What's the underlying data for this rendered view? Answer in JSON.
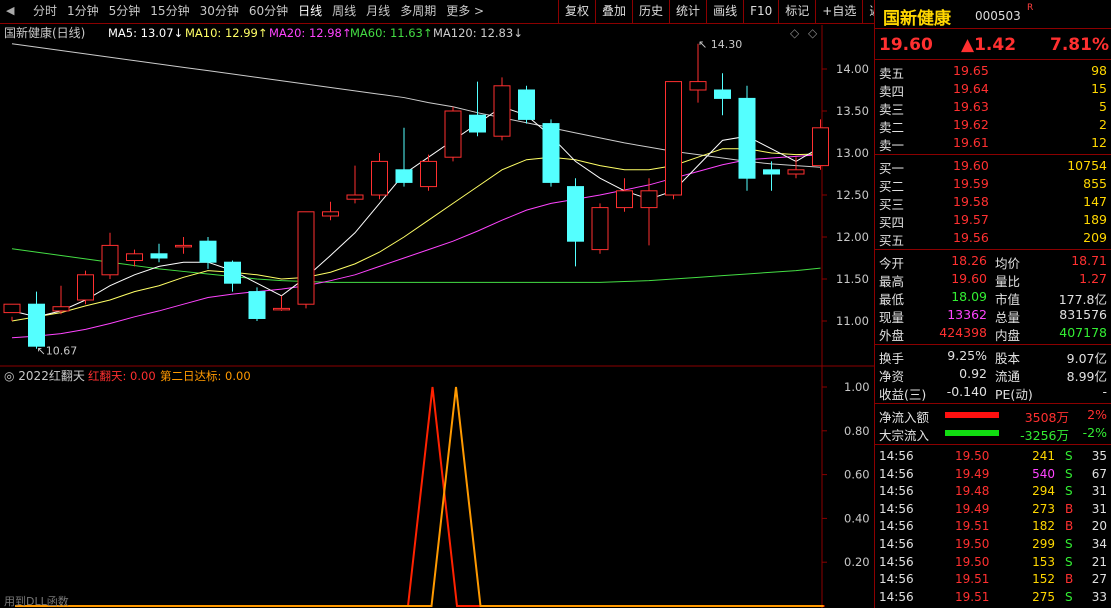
{
  "toolbar": {
    "periods": [
      "分时",
      "1分钟",
      "5分钟",
      "15分钟",
      "30分钟",
      "60分钟",
      "日线",
      "周线",
      "月线",
      "多周期",
      "更多 >"
    ],
    "active_period": "日线",
    "tools": [
      "复权",
      "叠加",
      "历史",
      "统计",
      "画线",
      "F10",
      "标记",
      "+自选",
      "返回"
    ]
  },
  "kline": {
    "title": "国新健康(日线)",
    "ma_labels": [
      {
        "text": "MA5: 13.07↓",
        "color": "#ffffff"
      },
      {
        "text": "MA10: 12.99↑",
        "color": "#ffff66"
      },
      {
        "text": "MA20: 12.98↑",
        "color": "#ff44ff"
      },
      {
        "text": "MA60: 11.63↑",
        "color": "#44dd44"
      },
      {
        "text": "MA120: 12.83↓",
        "color": "#cccccc"
      }
    ],
    "y_ticks": [
      "14.00",
      "13.50",
      "13.00",
      "12.50",
      "12.00",
      "11.50",
      "11.00"
    ],
    "high_mark": "14.30",
    "low_mark": "10.67",
    "candles": [
      [
        11.1,
        11.2,
        11.0,
        11.05
      ],
      [
        11.2,
        10.7,
        10.67,
        11.35
      ],
      [
        11.12,
        11.17,
        11.08,
        11.42
      ],
      [
        11.25,
        11.55,
        11.2,
        11.6
      ],
      [
        11.55,
        11.9,
        11.5,
        12.05
      ],
      [
        11.72,
        11.8,
        11.65,
        11.85
      ],
      [
        11.8,
        11.75,
        11.7,
        11.92
      ],
      [
        11.9,
        11.9,
        11.8,
        12.0
      ],
      [
        11.95,
        11.7,
        11.62,
        12.0
      ],
      [
        11.7,
        11.45,
        11.35,
        11.72
      ],
      [
        11.35,
        11.03,
        11.0,
        11.4
      ],
      [
        11.15,
        11.15,
        11.12,
        11.3
      ],
      [
        11.2,
        12.3,
        11.15,
        12.3
      ],
      [
        12.25,
        12.3,
        12.2,
        12.42
      ],
      [
        12.45,
        12.5,
        12.4,
        12.85
      ],
      [
        12.5,
        12.9,
        12.45,
        13.0
      ],
      [
        12.8,
        12.65,
        12.6,
        13.3
      ],
      [
        12.6,
        12.9,
        12.55,
        12.98
      ],
      [
        12.95,
        13.5,
        12.9,
        13.55
      ],
      [
        13.45,
        13.25,
        13.2,
        13.85
      ],
      [
        13.2,
        13.8,
        13.15,
        13.9
      ],
      [
        13.75,
        13.4,
        13.35,
        13.8
      ],
      [
        13.35,
        12.65,
        12.6,
        13.4
      ],
      [
        12.6,
        11.95,
        11.65,
        12.7
      ],
      [
        11.85,
        12.35,
        11.8,
        12.4
      ],
      [
        12.35,
        12.55,
        12.3,
        12.7
      ],
      [
        12.35,
        12.55,
        11.9,
        12.7
      ],
      [
        12.5,
        13.85,
        12.45,
        13.85
      ],
      [
        13.75,
        13.85,
        13.6,
        14.3
      ],
      [
        13.75,
        13.65,
        13.45,
        13.95
      ],
      [
        13.65,
        12.7,
        12.55,
        13.8
      ],
      [
        12.8,
        12.75,
        12.55,
        12.9
      ],
      [
        12.75,
        12.8,
        12.7,
        12.95
      ],
      [
        12.85,
        13.3,
        12.8,
        13.4
      ]
    ],
    "ma": {
      "ma5": [
        11.12,
        11.05,
        11.12,
        11.25,
        11.42,
        11.55,
        11.65,
        11.7,
        11.7,
        11.6,
        11.45,
        11.3,
        11.52,
        11.78,
        12.05,
        12.4,
        12.75,
        12.95,
        13.15,
        13.35,
        13.55,
        13.45,
        13.2,
        12.9,
        12.7,
        12.55,
        12.45,
        12.55,
        12.85,
        13.15,
        13.2,
        13.05,
        12.9,
        13.07
      ],
      "ma10": [
        11.0,
        11.05,
        11.1,
        11.18,
        11.25,
        11.35,
        11.42,
        11.52,
        11.6,
        11.58,
        11.55,
        11.5,
        11.52,
        11.58,
        11.68,
        11.82,
        12.0,
        12.2,
        12.4,
        12.6,
        12.8,
        12.92,
        12.95,
        12.92,
        12.85,
        12.8,
        12.8,
        12.85,
        12.95,
        13.05,
        13.05,
        13.0,
        12.98,
        12.99
      ],
      "ma20": [
        10.8,
        10.82,
        10.85,
        10.9,
        10.97,
        11.05,
        11.12,
        11.2,
        11.28,
        11.32,
        11.35,
        11.38,
        11.42,
        11.48,
        11.55,
        11.65,
        11.75,
        11.85,
        11.95,
        12.07,
        12.2,
        12.32,
        12.4,
        12.45,
        12.5,
        12.56,
        12.62,
        12.7,
        12.78,
        12.86,
        12.92,
        12.94,
        12.96,
        12.98
      ],
      "ma60": [
        11.86,
        11.82,
        11.78,
        11.74,
        11.7,
        11.66,
        11.62,
        11.59,
        11.56,
        11.53,
        11.5,
        11.48,
        11.47,
        11.46,
        11.46,
        11.46,
        11.46,
        11.46,
        11.46,
        11.46,
        11.46,
        11.46,
        11.46,
        11.46,
        11.46,
        11.47,
        11.48,
        11.5,
        11.52,
        11.54,
        11.56,
        11.58,
        11.6,
        11.63
      ],
      "ma120": [
        14.3,
        14.26,
        14.22,
        14.18,
        14.14,
        14.1,
        14.06,
        14.02,
        13.98,
        13.94,
        13.9,
        13.86,
        13.82,
        13.78,
        13.74,
        13.7,
        13.66,
        13.6,
        13.55,
        13.48,
        13.42,
        13.36,
        13.3,
        13.24,
        13.18,
        13.12,
        13.07,
        13.02,
        12.98,
        12.94,
        12.9,
        12.87,
        12.85,
        12.83
      ]
    }
  },
  "indicator": {
    "title": "2022红翻天",
    "labels": [
      {
        "text": "红翻天: 0.00",
        "color": "#ff3030"
      },
      {
        "text": "第二日达标: 0.00",
        "color": "#ff9900"
      }
    ],
    "y_ticks": [
      "1.00",
      "0.80",
      "0.60",
      "0.40",
      "0.20"
    ],
    "series1": [
      0,
      0,
      0,
      0,
      0,
      0,
      0,
      0,
      0,
      0,
      0,
      0,
      0,
      0,
      0,
      0,
      0,
      1,
      0,
      0,
      0,
      0,
      0,
      0,
      0,
      0,
      0,
      0,
      0,
      0,
      0,
      0,
      0,
      0
    ],
    "series2": [
      0,
      0,
      0,
      0,
      0,
      0,
      0,
      0,
      0,
      0,
      0,
      0,
      0,
      0,
      0,
      0,
      0,
      0,
      1,
      0,
      0,
      0,
      0,
      0,
      0,
      0,
      0,
      0,
      0,
      0,
      0,
      0,
      0,
      0
    ],
    "footer": "用到DLL函数"
  },
  "quote": {
    "name": "国新健康",
    "code": "000503",
    "r_badge": "R",
    "price": "19.60",
    "change": "▲1.42",
    "pct": "7.81%",
    "asks": [
      {
        "label": "卖五",
        "price": "19.65",
        "vol": "98"
      },
      {
        "label": "卖四",
        "price": "19.64",
        "vol": "15"
      },
      {
        "label": "卖三",
        "price": "19.63",
        "vol": "5"
      },
      {
        "label": "卖二",
        "price": "19.62",
        "vol": "2"
      },
      {
        "label": "卖一",
        "price": "19.61",
        "vol": "12"
      }
    ],
    "bids": [
      {
        "label": "买一",
        "price": "19.60",
        "vol": "10754"
      },
      {
        "label": "买二",
        "price": "19.59",
        "vol": "855"
      },
      {
        "label": "买三",
        "price": "19.58",
        "vol": "147"
      },
      {
        "label": "买四",
        "price": "19.57",
        "vol": "189"
      },
      {
        "label": "买五",
        "price": "19.56",
        "vol": "209"
      }
    ],
    "stats": [
      {
        "k1": "今开",
        "v1": "18.26",
        "c1": "red",
        "k2": "均价",
        "v2": "18.71",
        "c2": "red"
      },
      {
        "k1": "最高",
        "v1": "19.60",
        "c1": "red",
        "k2": "量比",
        "v2": "1.27",
        "c2": "red"
      },
      {
        "k1": "最低",
        "v1": "18.09",
        "c1": "grn",
        "k2": "市值",
        "v2": "177.8亿",
        "c2": "wht"
      },
      {
        "k1": "现量",
        "v1": "13362",
        "c1": "mag",
        "k2": "总量",
        "v2": "831576",
        "c2": "wht"
      },
      {
        "k1": "外盘",
        "v1": "424398",
        "c1": "red",
        "k2": "内盘",
        "v2": "407178",
        "c2": "grn"
      }
    ],
    "stats2": [
      {
        "k1": "换手",
        "v1": "9.25%",
        "k2": "股本",
        "v2": "9.07亿"
      },
      {
        "k1": "净资",
        "v1": "0.92",
        "k2": "流通",
        "v2": "8.99亿"
      },
      {
        "k1": "收益(三)",
        "v1": "-0.140",
        "k2": "PE(动)",
        "v2": "-"
      }
    ],
    "flows": [
      {
        "label": "净流入额",
        "value": "3508万",
        "pct": "2%",
        "color": "#ff1010",
        "val_cls": "red"
      },
      {
        "label": "大宗流入",
        "value": "-3256万",
        "pct": "-2%",
        "color": "#11dd11",
        "val_cls": "grn"
      }
    ],
    "ticks": [
      {
        "time": "14:56",
        "price": "19.50",
        "vol": "241",
        "side": "S",
        "n": "35",
        "vc": "yel"
      },
      {
        "time": "14:56",
        "price": "19.49",
        "vol": "540",
        "side": "S",
        "n": "67",
        "vc": "mag"
      },
      {
        "time": "14:56",
        "price": "19.48",
        "vol": "294",
        "side": "S",
        "n": "31",
        "vc": "yel"
      },
      {
        "time": "14:56",
        "price": "19.49",
        "vol": "273",
        "side": "B",
        "n": "31",
        "vc": "yel"
      },
      {
        "time": "14:56",
        "price": "19.51",
        "vol": "182",
        "side": "B",
        "n": "20",
        "vc": "yel"
      },
      {
        "time": "14:56",
        "price": "19.50",
        "vol": "299",
        "side": "S",
        "n": "34",
        "vc": "yel"
      },
      {
        "time": "14:56",
        "price": "19.50",
        "vol": "153",
        "side": "S",
        "n": "21",
        "vc": "yel"
      },
      {
        "time": "14:56",
        "price": "19.51",
        "vol": "152",
        "side": "B",
        "n": "27",
        "vc": "yel"
      },
      {
        "time": "14:56",
        "price": "19.51",
        "vol": "275",
        "side": "S",
        "n": "33",
        "vc": "yel"
      }
    ]
  },
  "colors": {
    "up": "#ff3030",
    "down": "#54ffff",
    "ma5": "#ffffff",
    "ma10": "#ffff66",
    "ma20": "#ff44ff",
    "ma60": "#44dd44",
    "ma120": "#cccccc",
    "ind1": "#ff2200",
    "ind2": "#ff9900"
  }
}
